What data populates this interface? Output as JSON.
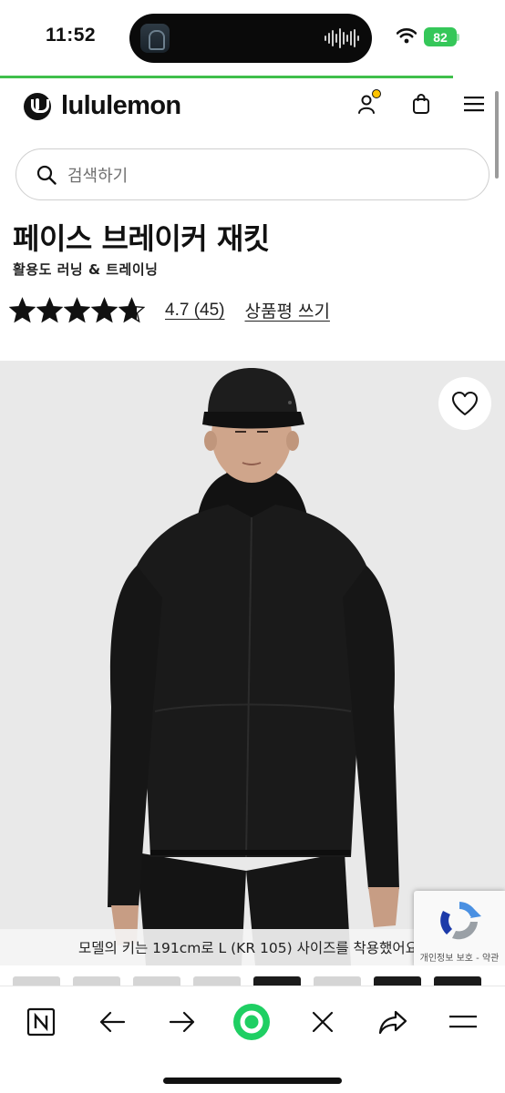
{
  "status_bar": {
    "time": "11:52",
    "battery": "82",
    "icons": [
      "podcast-app-icon",
      "audio-waveform-icon",
      "wifi-icon",
      "battery-icon"
    ]
  },
  "header": {
    "brand": "lululemon",
    "icons": [
      "lululemon-logo-icon",
      "account-icon",
      "shopping-bag-icon",
      "hamburger-menu-icon"
    ]
  },
  "search": {
    "placeholder": "검색하기"
  },
  "product": {
    "title": "페이스 브레이커 재킷",
    "category": "활용도 러닝 & 트레이닝",
    "rating_display": "4.7 (45)",
    "rating_value": 4.7,
    "stars_max": 5,
    "write_review": "상품평 쓰기",
    "model_note": "모델의 키는 191cm로 L (KR 105) 사이즈를 착용했어요",
    "wishlist_icon": "heart-icon"
  },
  "recaptcha": {
    "text": "개인정보 보호 - 약관"
  },
  "browser_toolbar": {
    "items": [
      "naver-n-icon",
      "back-arrow-icon",
      "forward-arrow-icon",
      "green-home-icon",
      "close-icon",
      "share-icon",
      "menu-icon"
    ]
  },
  "colors": {
    "progress_bar": "#3fbf4b",
    "battery": "#35c759",
    "accent_dot": "#ffc400",
    "home_ring": "#1fcf63"
  }
}
